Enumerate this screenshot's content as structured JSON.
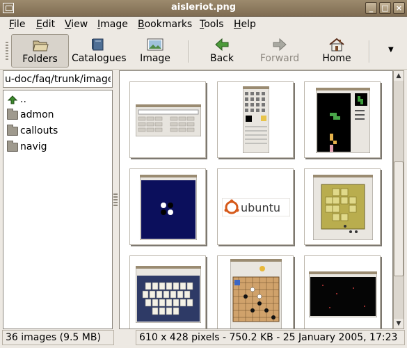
{
  "window": {
    "title": "aisleriot.png"
  },
  "menu": {
    "items": [
      {
        "label": "File",
        "mnemonic": "F"
      },
      {
        "label": "Edit",
        "mnemonic": "E"
      },
      {
        "label": "View",
        "mnemonic": "V"
      },
      {
        "label": "Image",
        "mnemonic": "I"
      },
      {
        "label": "Bookmarks",
        "mnemonic": "B"
      },
      {
        "label": "Tools",
        "mnemonic": "T"
      },
      {
        "label": "Help",
        "mnemonic": "H"
      }
    ]
  },
  "toolbar": {
    "folders": "Folders",
    "catalogues": "Catalogues",
    "image": "Image",
    "back": "Back",
    "forward": "Forward",
    "home": "Home"
  },
  "location": {
    "value": "u-doc/faq/trunk/images"
  },
  "folders": [
    {
      "name": "..",
      "icon": "up-arrow-icon"
    },
    {
      "name": "admon",
      "icon": "folder-icon"
    },
    {
      "name": "callouts",
      "icon": "folder-icon"
    },
    {
      "name": "navig",
      "icon": "folder-icon"
    }
  ],
  "thumbnails": [
    {
      "name": "calculator-thumbnail"
    },
    {
      "name": "gimp-toolbox-thumbnail"
    },
    {
      "name": "tetris-thumbnail"
    },
    {
      "name": "othello-thumbnail"
    },
    {
      "name": "ubuntu-logo-thumbnail",
      "text": "ubuntu"
    },
    {
      "name": "puzzle-thumbnail"
    },
    {
      "name": "mahjongg-thumbnail"
    },
    {
      "name": "go-board-thumbnail"
    },
    {
      "name": "dark-game-thumbnail"
    }
  ],
  "status": {
    "count": "36 images (9.5 MB)",
    "info": "610 x 428 pixels - 750.2 KB - 25 January 2005, 17:23"
  }
}
